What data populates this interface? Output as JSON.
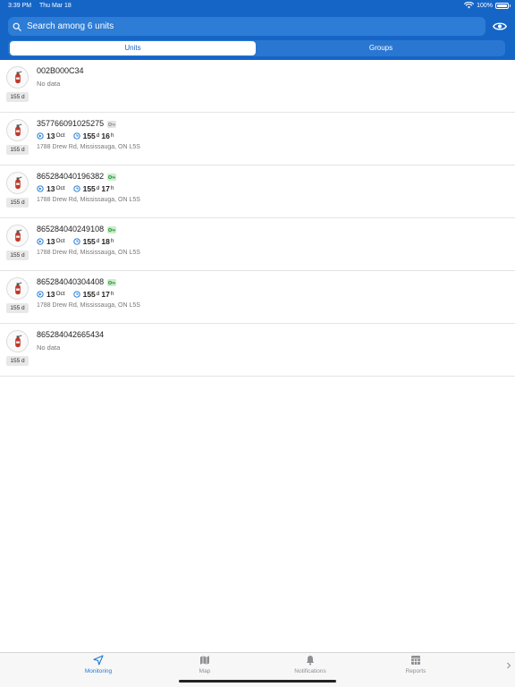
{
  "status_bar": {
    "time": "3:39 PM",
    "date": "Thu Mar 18",
    "battery": "100%"
  },
  "search": {
    "placeholder": "Search among 6 units",
    "value": ""
  },
  "segments": {
    "units": "Units",
    "groups": "Groups",
    "selected": "Units"
  },
  "units": [
    {
      "name": "002B000C34",
      "age": "155 d",
      "status": "No data",
      "has_data": false
    },
    {
      "name": "357766091025275",
      "age": "155 d",
      "key": "gray",
      "has_data": true,
      "trip_day": "13",
      "trip_month": "Oct",
      "duration_days": "155",
      "duration_days_unit": "d",
      "duration_hours": "16",
      "duration_hours_unit": "h",
      "address": "1788 Drew Rd, Mississauga, ON L5S"
    },
    {
      "name": "865284040196382",
      "age": "155 d",
      "key": "green",
      "has_data": true,
      "trip_day": "13",
      "trip_month": "Oct",
      "duration_days": "155",
      "duration_days_unit": "d",
      "duration_hours": "17",
      "duration_hours_unit": "h",
      "address": "1788 Drew Rd, Mississauga, ON L5S"
    },
    {
      "name": "865284040249108",
      "age": "155 d",
      "key": "green",
      "has_data": true,
      "trip_day": "13",
      "trip_month": "Oct",
      "duration_days": "155",
      "duration_days_unit": "d",
      "duration_hours": "18",
      "duration_hours_unit": "h",
      "address": "1788 Drew Rd, Mississauga, ON L5S"
    },
    {
      "name": "865284040304408",
      "age": "155 d",
      "key": "green",
      "has_data": true,
      "trip_day": "13",
      "trip_month": "Oct",
      "duration_days": "155",
      "duration_days_unit": "d",
      "duration_hours": "17",
      "duration_hours_unit": "h",
      "address": "1788 Drew Rd, Mississauga, ON L5S"
    },
    {
      "name": "865284042665434",
      "age": "155 d",
      "status": "No data",
      "has_data": false
    }
  ],
  "tabs": [
    {
      "label": "Monitoring",
      "icon": "navigation-arrow-icon",
      "active": true
    },
    {
      "label": "Map",
      "icon": "map-icon",
      "active": false
    },
    {
      "label": "Notifications",
      "icon": "bell-icon",
      "active": false
    },
    {
      "label": "Reports",
      "icon": "reports-grid-icon",
      "active": false
    }
  ],
  "colors": {
    "primary": "#1565c7",
    "accent": "#1e7ad6",
    "key_green": "#2e9e44",
    "key_gray": "#9a9a9a"
  }
}
